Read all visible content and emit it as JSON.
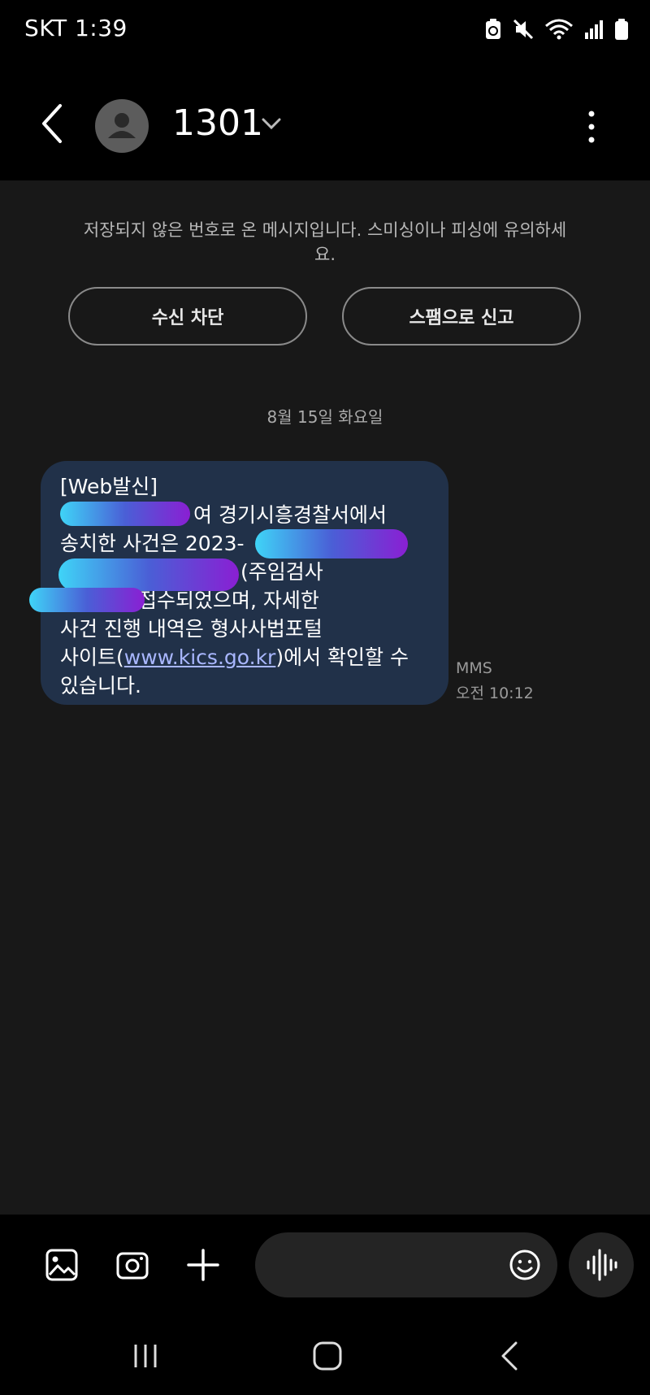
{
  "status_bar": {
    "carrier_time": "SKT 1:39",
    "icons": [
      "battery-saver-icon",
      "mute-icon",
      "wifi-icon",
      "signal-icon",
      "battery-icon"
    ]
  },
  "header": {
    "contact": "1301",
    "icons": [
      "back-icon",
      "avatar-person-icon",
      "chevron-down-icon",
      "more-vertical-icon"
    ]
  },
  "warning": {
    "text": "저장되지 않은 번호로 온 메시지입니다. 스미싱이나 피싱에 유의하세요."
  },
  "actions": {
    "block_label": "수신 차단",
    "spam_label": "스팸으로 신고"
  },
  "thread": {
    "date": "8월 15일 화요일",
    "message": {
      "lines": [
        "[Web발신]",
        "여 경기시흥경찰서에서",
        "송치한 사건은 2023-",
        "(주임검사",
        "접수되었으며, 자세한",
        "사건 진행 내역은 형사사법포털",
        "사이트(",
        "www.kics.go.kr",
        ")에서 확인할 수",
        "있습니다."
      ],
      "type": "MMS",
      "time": "오전 10:12",
      "redaction_color_start": "#3fd4f7",
      "redaction_color_end": "#8a1fd3"
    }
  },
  "composer": {
    "icons": [
      "gallery-icon",
      "camera-icon",
      "plus-icon",
      "emoji-icon",
      "voice-wave-icon"
    ]
  },
  "nav": {
    "icons": [
      "recent-apps-icon",
      "home-icon",
      "nav-back-icon"
    ]
  },
  "colors": {
    "background": "#181818",
    "bubble": "#213149",
    "link": "#a9b7ff"
  }
}
